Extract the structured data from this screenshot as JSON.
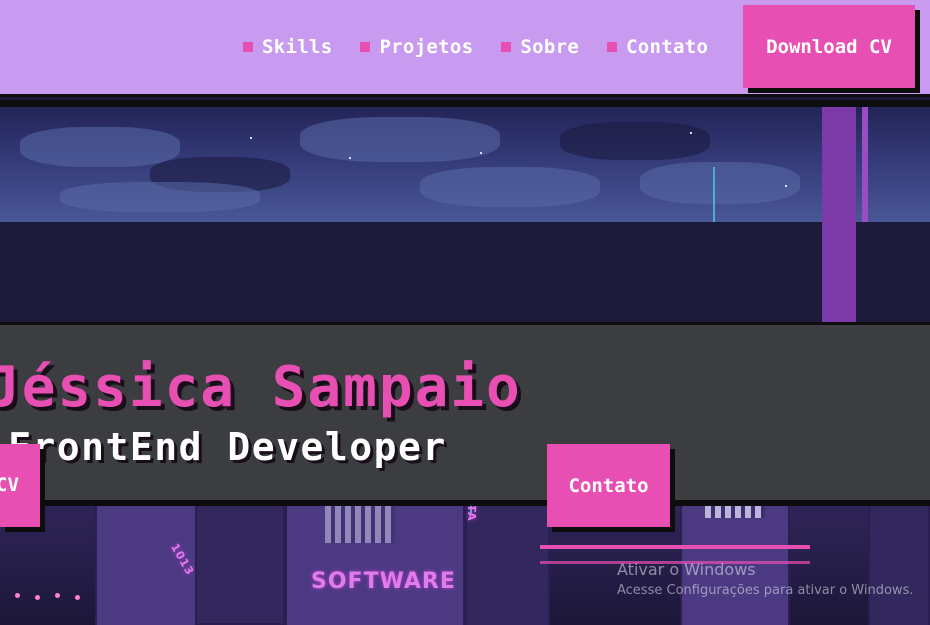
{
  "nav": {
    "items": [
      {
        "label": "Skills"
      },
      {
        "label": "Projetos"
      },
      {
        "label": "Sobre"
      },
      {
        "label": "Contato"
      }
    ],
    "download_label": "Download CV"
  },
  "hero": {
    "name": "Jéssica Sampaio",
    "role": "FrontEnd Developer",
    "cv_button_label": "CV",
    "contact_button_label": "Contato",
    "signs": {
      "software": "SOFTWARE",
      "vertical": "VISTAPATA",
      "small": "1013"
    }
  },
  "watermark": {
    "title": "Ativar o Windows",
    "subtitle": "Acesse Configurações para ativar o Windows."
  },
  "colors": {
    "header_bg": "#c89af0",
    "accent_pink": "#e84fb3",
    "banner_bg": "#3b3d40",
    "border": "#0d0d0d"
  }
}
